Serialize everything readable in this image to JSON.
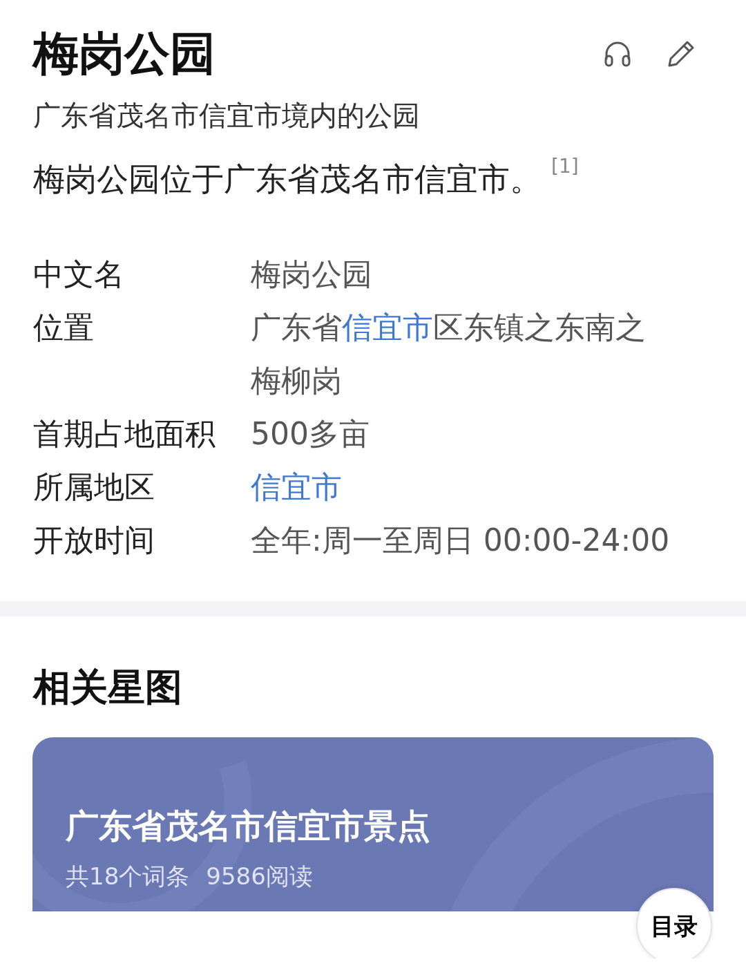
{
  "title": "梅岗公园",
  "subtitle": "广东省茂名市信宜市境内的公园",
  "summary": "梅岗公园位于广东省茂名市信宜市。$^{[1]}$",
  "info": [
    {
      "label": "中文名",
      "value": [
        {
          "text": "梅岗公园",
          "link": false
        }
      ]
    },
    {
      "label": "位置",
      "value": [
        {
          "text": "广东省",
          "link": false
        },
        {
          "text": "信宜市",
          "link": true
        },
        {
          "text": "区东镇之东南之",
          "link": false
        },
        {
          "text": "梅柳岗",
          "link": false
        }
      ]
    },
    {
      "label": "首期占地面积",
      "value": [
        {
          "text": "500多亩",
          "link": false
        }
      ]
    },
    {
      "label": "所属地区",
      "value": [
        {
          "text": "信宜市",
          "link": true
        }
      ]
    },
    {
      "label": "开放时间",
      "value": [
        {
          "text": "全年:周一至周日 00:00-24:00",
          "link": false
        }
      ]
    }
  ],
  "section_title": "相关星图",
  "star_card": {
    "title": "广东省茂名市信宜市景点",
    "stats": [
      "共18个词条",
      "9586阅读"
    ]
  },
  "toc_button": "目录"
}
